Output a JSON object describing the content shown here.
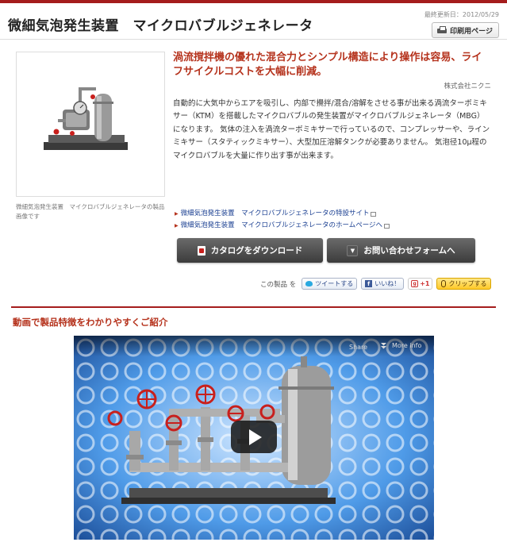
{
  "header": {
    "title": "微細気泡発生装置　マイクロバブルジェネレータ",
    "updated": "最終更新日：2012/05/29",
    "print_label": "印刷用ページ"
  },
  "product": {
    "image_caption": "微細気泡発生装置　マイクロバブルジェネレータの製品画像です",
    "headline": "渦流撹拌機の優れた混合力とシンプル構造により操作は容易、ライフサイクルコストを大幅に削減。",
    "company": "株式会社ニクニ",
    "description": "自動的に大気中からエアを吸引し、内部で攪拌/混合/溶解をさせる事が出来る渦流ターボミキサー（KTM）を搭載したマイクロバブルの発生装置がマイクロバブルジェネレータ（MBG）になります。 気体の注入を渦流ターボミキサーで行っているので、コンプレッサーや、ラインミキサー（スタティックミキサー）、大型加圧溶解タンクが必要ありません。 気泡径10μ程のマイクロバブルを大量に作り出す事が出来ます。",
    "links": [
      "微細気泡発生装置　マイクロバブルジェネレータの特設サイト",
      "微細気泡発生装置　マイクロバブルジェネレータのホームページへ"
    ],
    "catalog_button": "カタログをダウンロード",
    "contact_button": "お問い合わせフォームへ"
  },
  "share": {
    "label": "この製品 を",
    "tweet": "ツイートする",
    "like": "いいね！",
    "gplus": "+1",
    "clip": "クリップする"
  },
  "video": {
    "heading": "動画で製品特徴をわかりやすくご紹介",
    "share_label": "Share",
    "more_info_label": "More info"
  },
  "colors": {
    "accent": "#a51d1d",
    "headline": "#b5321c",
    "link": "#1a3f91"
  }
}
